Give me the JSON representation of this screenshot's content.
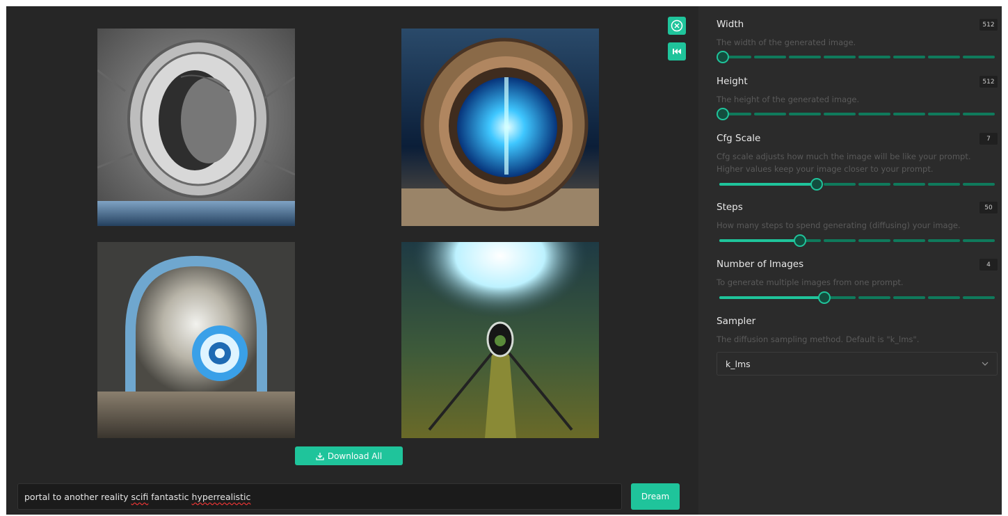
{
  "gallery": {
    "download_all_label": "Download All"
  },
  "prompt": {
    "text_before": "portal to another reality ",
    "text_word_a": "scifi",
    "text_mid": " fantastic ",
    "text_word_b": "hyperrealistic",
    "dream_label": "Dream"
  },
  "settings": {
    "width": {
      "title": "Width",
      "value": "512",
      "description": "The width of the generated image.",
      "fraction": 0.0
    },
    "height": {
      "title": "Height",
      "value": "512",
      "description": "The height of the generated image.",
      "fraction": 0.0
    },
    "cfg": {
      "title": "Cfg Scale",
      "value": "7",
      "description_1": "Cfg scale adjusts how much the image will be like your prompt.",
      "description_2": "Higher values keep your image closer to your prompt.",
      "fraction": 0.35
    },
    "steps": {
      "title": "Steps",
      "value": "50",
      "description": "How many steps to spend generating (diffusing) your image.",
      "fraction": 0.29
    },
    "num_images": {
      "title": "Number of Images",
      "value": "4",
      "description": "To generate multiple images from one prompt.",
      "fraction": 0.38
    },
    "sampler": {
      "title": "Sampler",
      "description": "The diffusion sampling method. Default is \"k_lms\".",
      "selected": "k_lms"
    }
  },
  "colors": {
    "accent": "#1fc49b",
    "track": "#0f7a5c",
    "background": "#262626"
  }
}
